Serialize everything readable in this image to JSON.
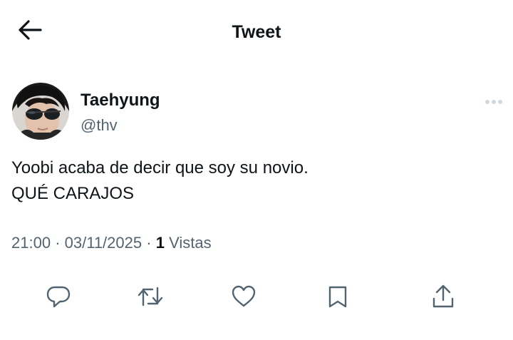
{
  "header": {
    "title": "Tweet",
    "back_icon": "arrow-left-icon"
  },
  "author": {
    "display_name": "Taehyung",
    "handle": "@thv",
    "avatar": "profile-photo-sunglasses"
  },
  "tweet": {
    "lines": [
      "Yoobi acaba de decir que soy su novio.",
      "QUÉ CARAJOS"
    ],
    "time": "21:00",
    "date": "03/11/2025",
    "separator": "·",
    "views_count": "1",
    "views_label": "Vistas"
  },
  "actions": [
    {
      "name": "reply",
      "icon": "reply-icon"
    },
    {
      "name": "retweet",
      "icon": "retweet-icon"
    },
    {
      "name": "like",
      "icon": "heart-icon"
    },
    {
      "name": "bookmark",
      "icon": "bookmark-icon"
    },
    {
      "name": "share",
      "icon": "share-icon"
    }
  ],
  "colors": {
    "text": "#0f1419",
    "secondary": "#536471",
    "icon": "#536471",
    "more_dots": "#cfd9de"
  }
}
